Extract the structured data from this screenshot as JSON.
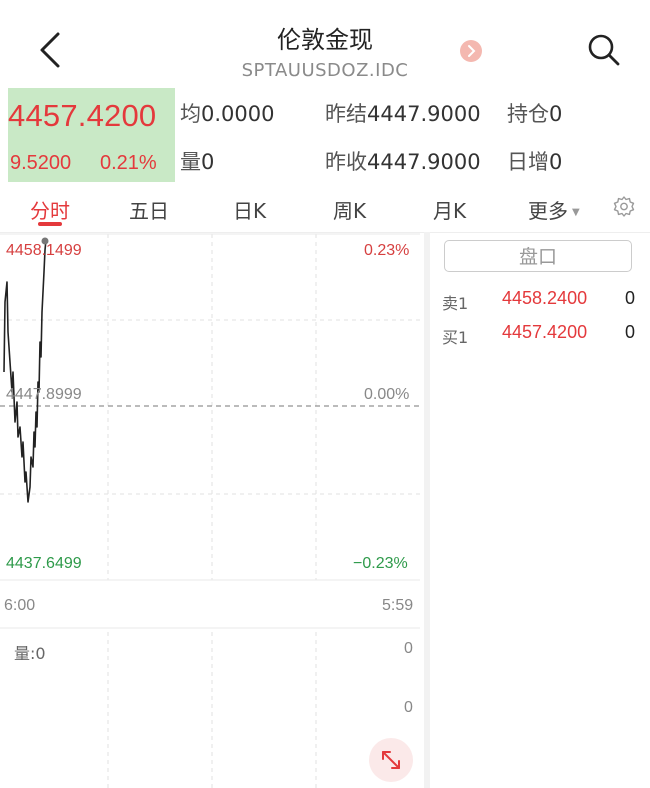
{
  "header": {
    "title": "伦敦金现",
    "subtitle": "SPTAUUSDOZ.IDC"
  },
  "quote": {
    "price": "4457.4200",
    "change": "9.5200",
    "change_pct": "0.21%",
    "avg_label": "均",
    "avg_value": "0.0000",
    "prev_settle_label": "昨结",
    "prev_settle_value": "4447.9000",
    "position_label": "持仓",
    "position_value": "0",
    "volume_label": "量",
    "volume_value": "0",
    "prev_close_label": "昨收",
    "prev_close_value": "4447.9000",
    "daily_inc_label": "日增",
    "daily_inc_value": "0",
    "colors": {
      "up": "#e4393c",
      "down": "#2e9a4a",
      "price_bg": "#c9e9c6"
    }
  },
  "tabs": [
    {
      "label": "分时",
      "active": true
    },
    {
      "label": "五日",
      "active": false
    },
    {
      "label": "日K",
      "active": false
    },
    {
      "label": "周K",
      "active": false
    },
    {
      "label": "月K",
      "active": false
    },
    {
      "label": "更多",
      "active": false
    }
  ],
  "chart": {
    "y_top": "4458.1499",
    "y_mid": "4447.8999",
    "y_bottom": "4437.6499",
    "pct_top": "0.23%",
    "pct_mid": "0.00%",
    "pct_bottom": "−0.23%",
    "time_start": "6:00",
    "time_end": "5:59",
    "volume_label": "量:0",
    "volume_max": "0",
    "volume_min": "0"
  },
  "order_book": {
    "button_label": "盘口",
    "rows": [
      {
        "label": "卖1",
        "price": "4458.2400",
        "volume": "0"
      },
      {
        "label": "买1",
        "price": "4457.4200",
        "volume": "0"
      }
    ]
  },
  "icons": [
    "back-icon",
    "next-circle-icon",
    "search-icon",
    "dropdown-caret-icon",
    "settings-gear-icon",
    "expand-icon"
  ]
}
